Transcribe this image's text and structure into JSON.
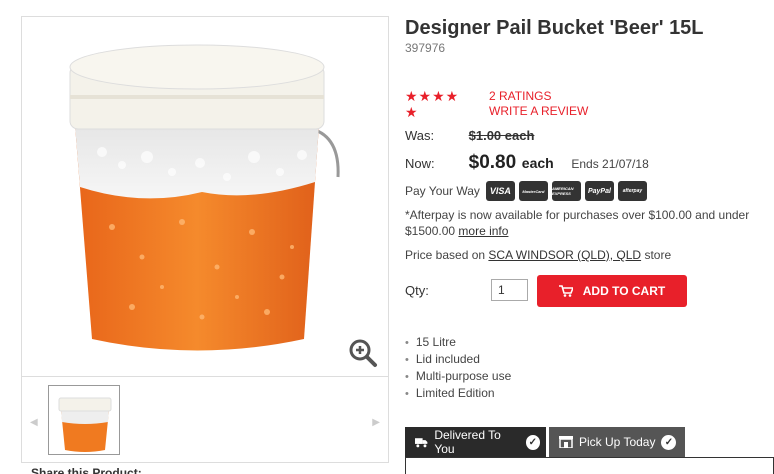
{
  "product": {
    "title": "Designer Pail Bucket 'Beer' 15L",
    "sku": "397976",
    "rating_stars": "★★★★ ★",
    "ratings_count": "2 RATINGS",
    "write_review": "WRITE A REVIEW"
  },
  "pricing": {
    "was_label": "Was:",
    "was_value": "$1.00 each",
    "now_label": "Now:",
    "now_value": "$0.80",
    "now_unit": "each",
    "ends": "Ends 21/07/18"
  },
  "payment": {
    "label": "Pay Your Way",
    "methods": [
      "VISA",
      "MasterCard",
      "AMERICAN EXPRESS",
      "PayPal",
      "afterpay"
    ],
    "afterpay_note": "*Afterpay is now available for purchases over $100.00 and under $1500.00",
    "more_info": "more info"
  },
  "store": {
    "prefix": "Price based on",
    "name": "SCA WINDSOR (QLD), QLD",
    "suffix": "store"
  },
  "cart": {
    "qty_label": "Qty:",
    "qty_value": "1",
    "add_to_cart": "ADD TO CART"
  },
  "features": [
    "15 Litre",
    "Lid included",
    "Multi-purpose use",
    "Limited Edition"
  ],
  "tabs": [
    {
      "label": "Delivered To You"
    },
    {
      "label": "Pick Up Today"
    }
  ],
  "gallery": {
    "share_label": "Share this Product:"
  },
  "colors": {
    "accent": "#e8202a",
    "beer": "#f07a20",
    "tab_dark": "#2a2a2a"
  },
  "icons": {
    "zoom": "zoom-in-icon",
    "cart": "cart-icon",
    "truck": "truck-icon",
    "store": "store-icon",
    "check": "check-icon"
  }
}
